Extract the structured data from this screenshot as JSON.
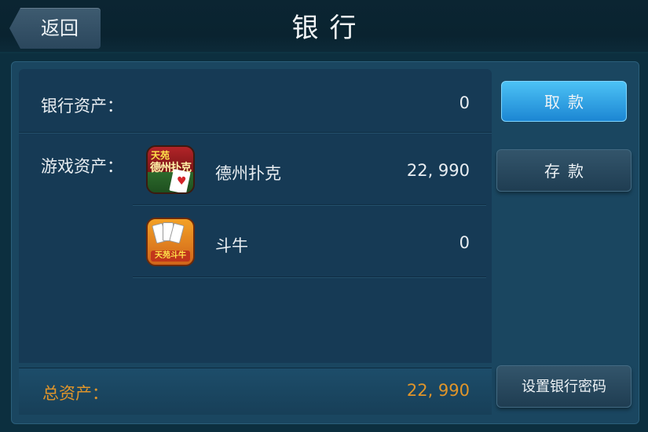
{
  "header": {
    "back_label": "返回",
    "title": "银行"
  },
  "bank": {
    "label": "银行资产：",
    "value": "0"
  },
  "game_assets": {
    "label": "游戏资产：",
    "items": [
      {
        "name": "德州扑克",
        "value": "22, 990",
        "icon": "texas-poker-icon",
        "icon_text_top": "天苑",
        "icon_text_main": "德州扑克"
      },
      {
        "name": "斗牛",
        "value": "0",
        "icon": "douniu-icon",
        "icon_text_brand": "天苑斗牛"
      }
    ]
  },
  "total": {
    "label": "总资产：",
    "value": "22, 990"
  },
  "buttons": {
    "withdraw": "取款",
    "deposit": "存款",
    "set_password": "设置银行密码"
  },
  "colors": {
    "accent_orange": "#e0952a",
    "withdraw_blue": "#1c86d3",
    "panel": "#163a55"
  }
}
